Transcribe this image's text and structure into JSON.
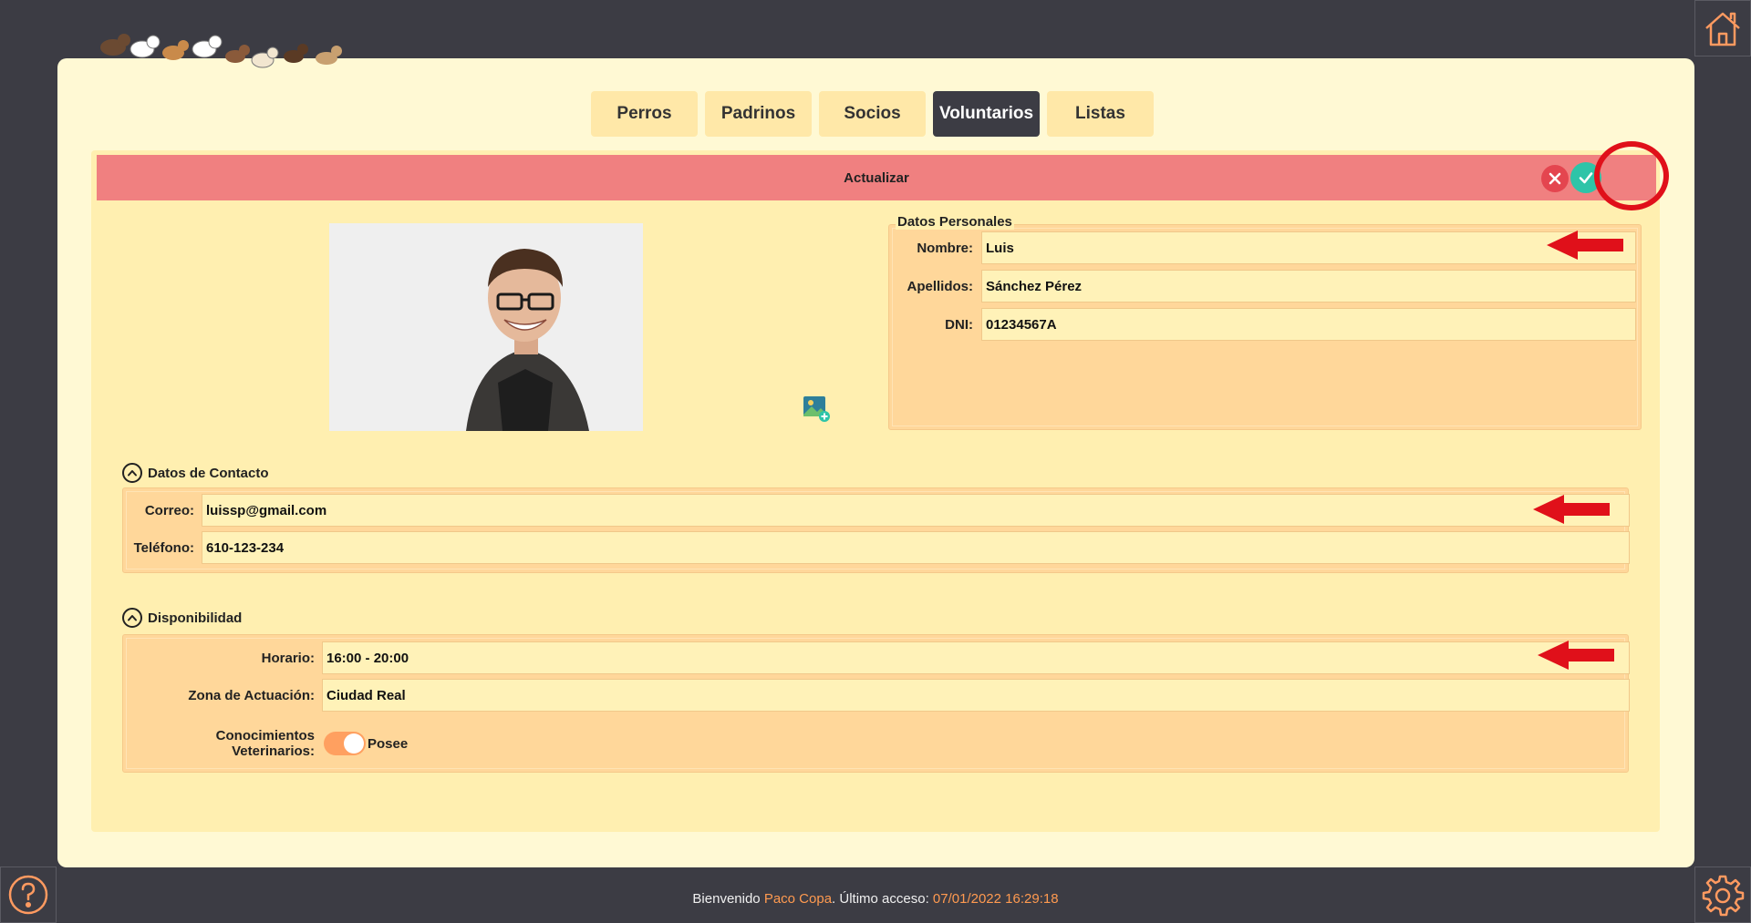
{
  "tabs": [
    {
      "label": "Perros",
      "active": false
    },
    {
      "label": "Padrinos",
      "active": false
    },
    {
      "label": "Socios",
      "active": false
    },
    {
      "label": "Voluntarios",
      "active": true
    },
    {
      "label": "Listas",
      "active": false
    }
  ],
  "header": {
    "title": "Actualizar"
  },
  "personal": {
    "legend": "Datos Personales",
    "nombre_label": "Nombre:",
    "nombre_value": "Luis",
    "apellidos_label": "Apellidos:",
    "apellidos_value": "Sánchez Pérez",
    "dni_label": "DNI:",
    "dni_value": "01234567A"
  },
  "contacto": {
    "title": "Datos de Contacto",
    "correo_label": "Correo:",
    "correo_value": "luissp@gmail.com",
    "telefono_label": "Teléfono:",
    "telefono_value": "610-123-234"
  },
  "disponibilidad": {
    "title": "Disponibilidad",
    "horario_label": "Horario:",
    "horario_value": "16:00 - 20:00",
    "zona_label": "Zona de Actuación:",
    "zona_value": "Ciudad Real",
    "vet_label": "Conocimientos Veterinarios:",
    "vet_toggle_label": "Posee",
    "vet_toggle_on": true
  },
  "footer": {
    "prefix": "Bienvenido",
    "user": "Paco Copa",
    "middle": ". Último acceso:",
    "last_access": "07/01/2022 16:29:18"
  },
  "colors": {
    "accent": "#ffa060",
    "header": "#f08080",
    "confirm": "#2ec4a8",
    "cancel": "#e4454f"
  }
}
